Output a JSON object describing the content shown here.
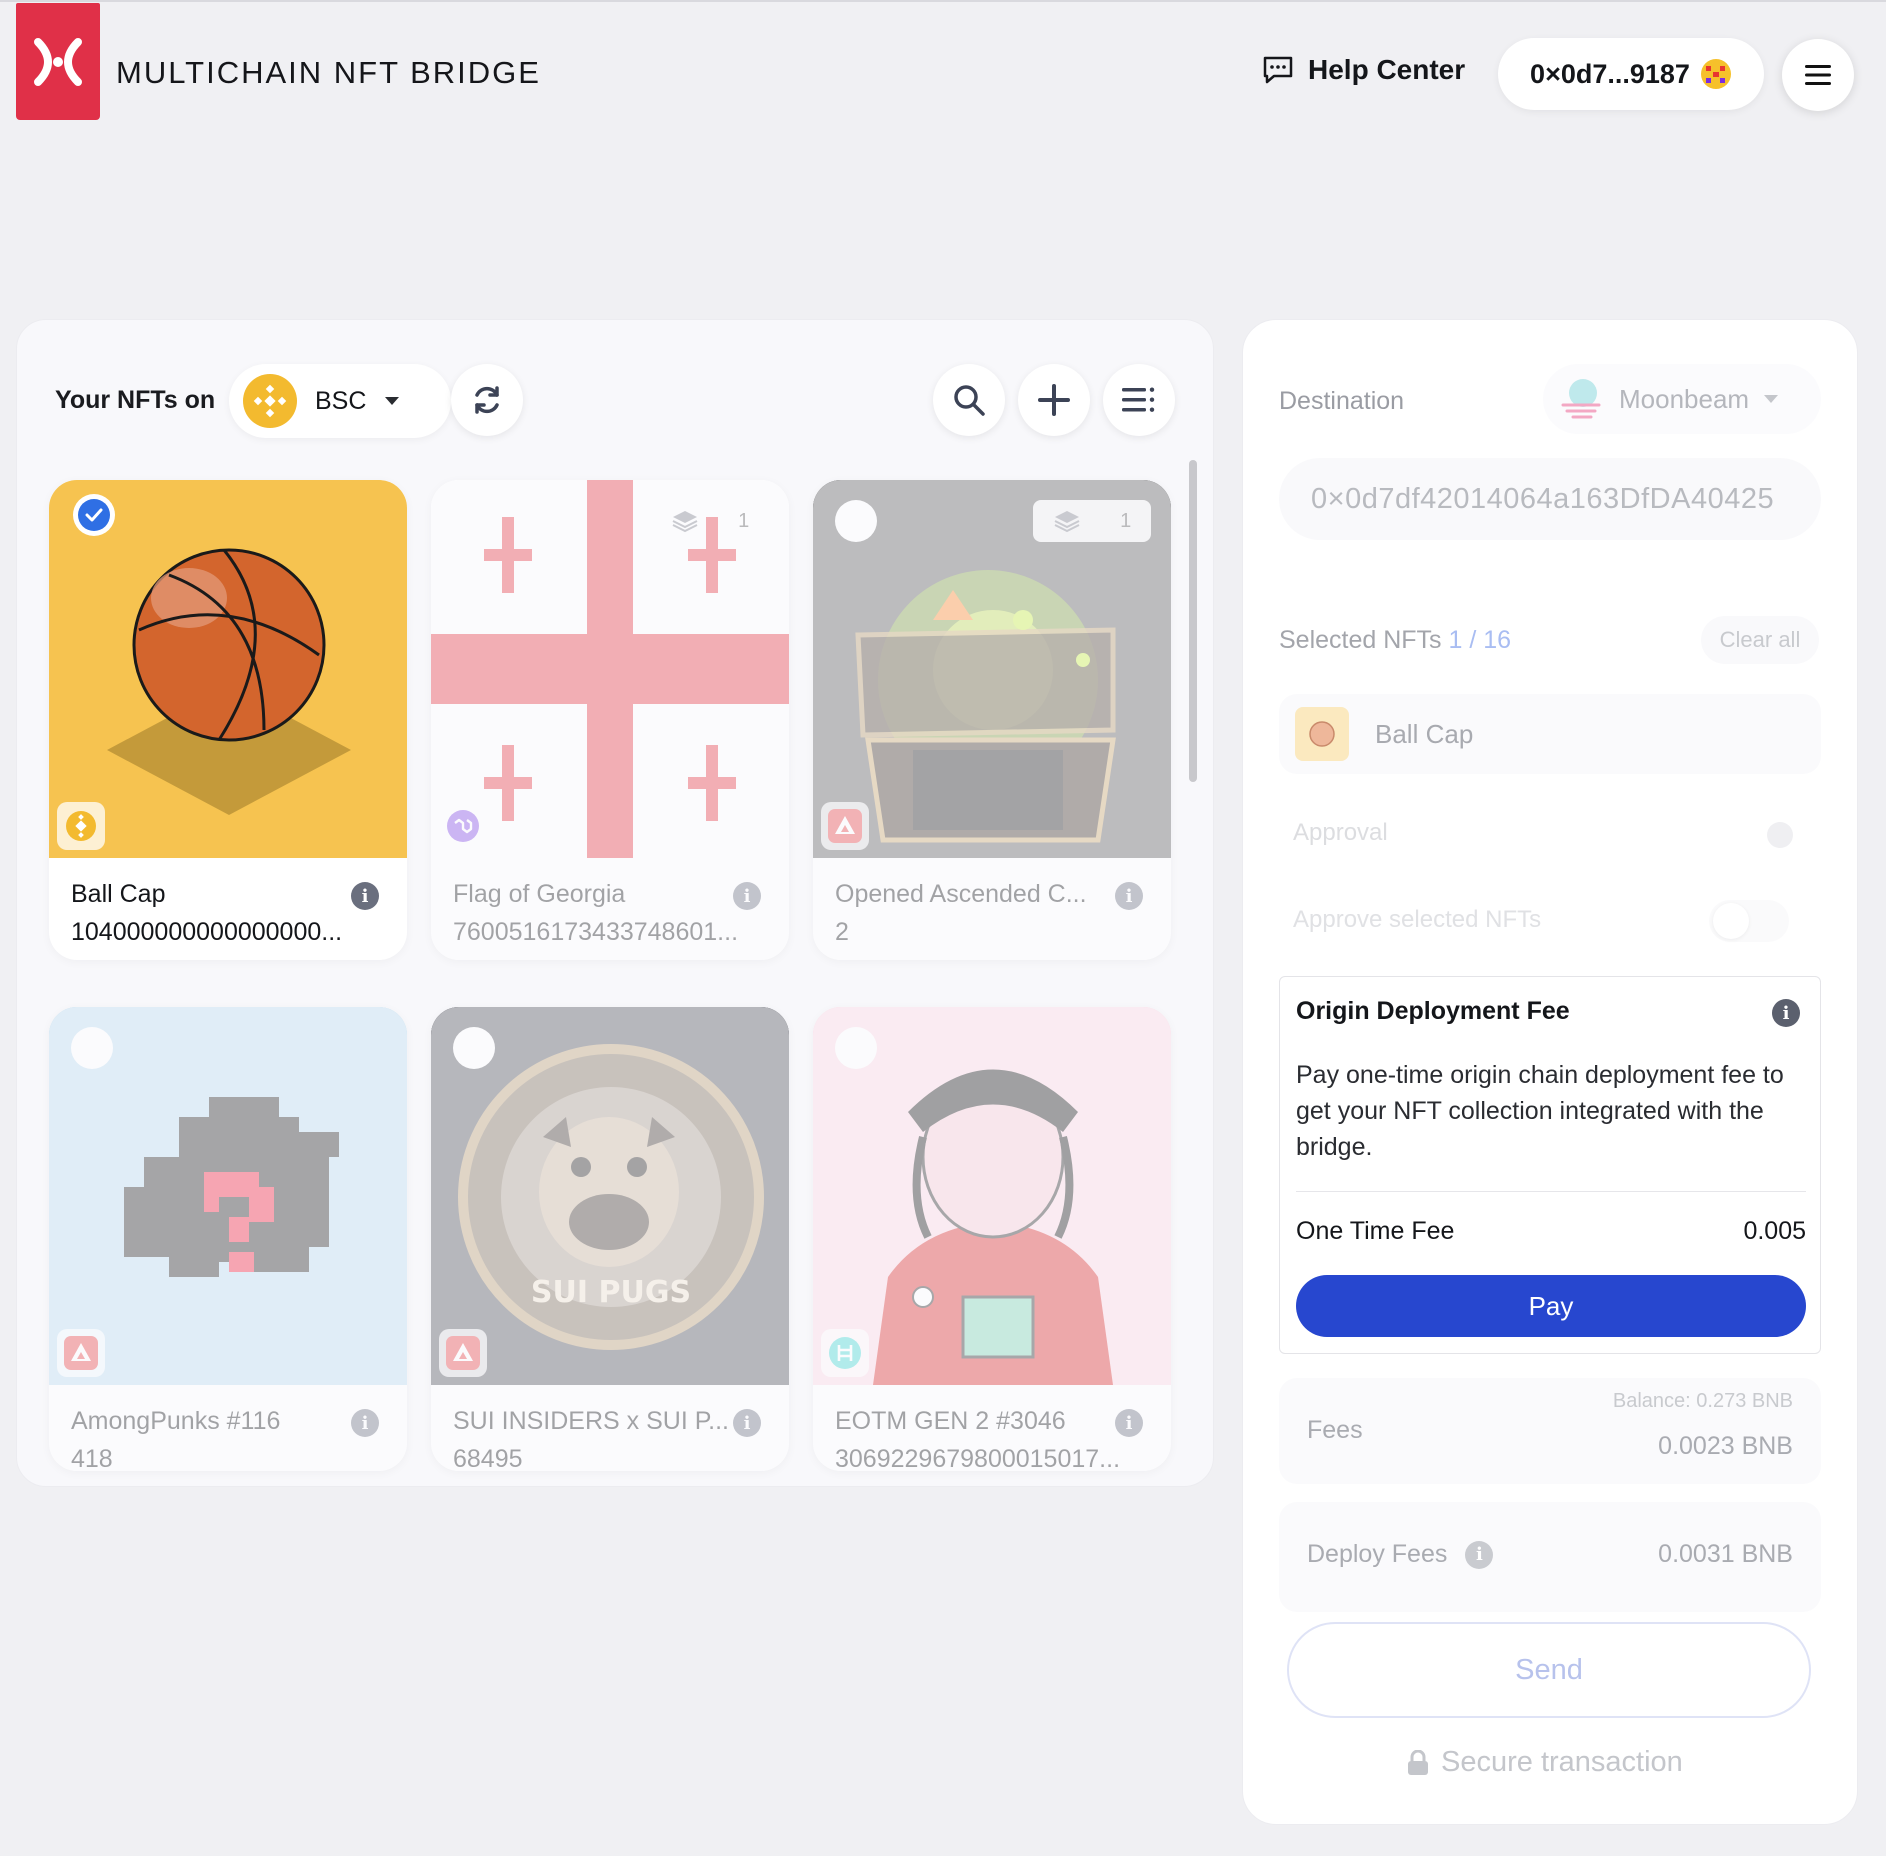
{
  "header": {
    "brand": "MULTICHAIN NFT BRIDGE",
    "help_label": "Help Center",
    "wallet_address": "0×0d7...9187",
    "brand_color": "#e03048"
  },
  "nft_panel": {
    "title": "Your NFTs on",
    "chain": "BSC",
    "cards": [
      {
        "name": "Ball Cap",
        "token_id": "104000000000000000...",
        "selected": true,
        "chain_icon": "bnb-icon"
      },
      {
        "name": "Flag of Georgia",
        "token_id": "7600516173433748601...",
        "count": "1",
        "chain_icon": "polygon-icon"
      },
      {
        "name": "Opened Ascended C...",
        "token_id": "2",
        "count": "1",
        "chain_icon": "avalanche-icon"
      },
      {
        "name": "AmongPunks #116",
        "token_id": "418",
        "chain_icon": "avalanche-icon"
      },
      {
        "name": "SUI INSIDERS x SUI P...",
        "token_id": "68495",
        "image_text": "SUI PUGS",
        "chain_icon": "avalanche-icon"
      },
      {
        "name": "EOTM GEN 2 #3046",
        "token_id": "3069229679800015017...",
        "chain_icon": "hedera-icon"
      }
    ]
  },
  "bridge_panel": {
    "destination_label": "Destination",
    "destination_chain": "Moonbeam",
    "destination_address": "0×0d7df42014064a163DfDA40425",
    "selected_label": "Selected NFTs",
    "selected_count": "1 / 16",
    "clear_all": "Clear all",
    "selected_item": "Ball Cap",
    "approval_label": "Approval",
    "approve_label": "Approve selected NFTs",
    "fee_card": {
      "title": "Origin Deployment Fee",
      "description": "Pay one-time origin chain deployment fee to get your NFT collection integrated with the bridge.",
      "fee_label": "One Time Fee",
      "fee_value": "0.005",
      "pay_label": "Pay"
    },
    "balance": "Balance: 0.273 BNB",
    "fees_label": "Fees",
    "fees_value": "0.0023 BNB",
    "deploy_label": "Deploy Fees",
    "deploy_value": "0.0031 BNB",
    "send_label": "Send",
    "secure_label": "Secure transaction",
    "accent_color": "#2747cf"
  }
}
